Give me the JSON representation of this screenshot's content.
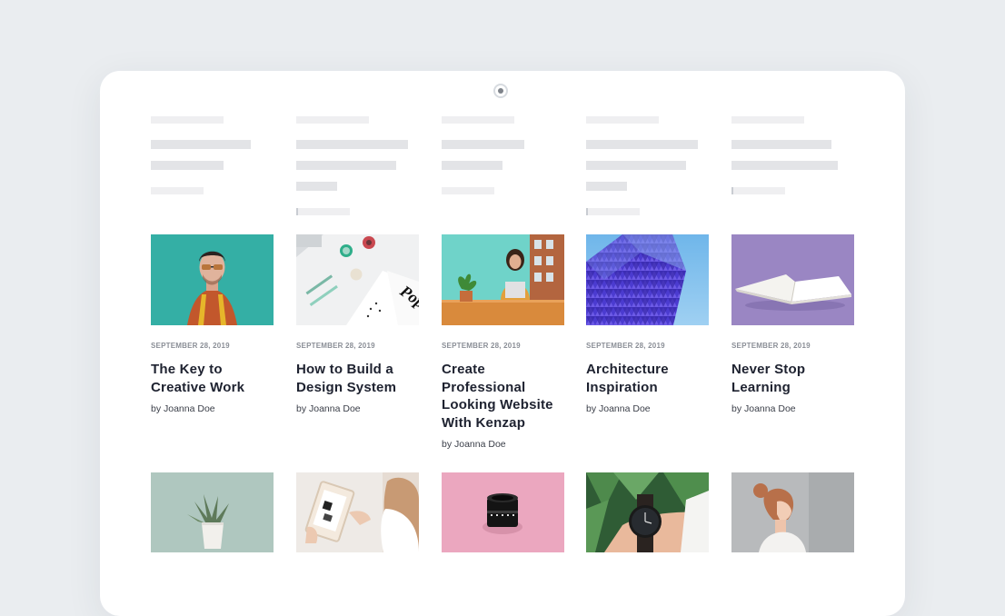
{
  "posts_top": [
    {
      "date": "SEPTEMBER 28, 2019",
      "title": "The Key to Creative Work",
      "author": "by Joanna Doe",
      "image": "man-portrait-teal"
    },
    {
      "date": "SEPTEMBER 28, 2019",
      "title": "How to Build a Design System",
      "author": "by Joanna Doe",
      "image": "desk-flatlay"
    },
    {
      "date": "SEPTEMBER 28, 2019",
      "title": "Create Professional Looking Website With Kenzap",
      "author": "by Joanna Doe",
      "image": "woman-laptop"
    },
    {
      "date": "SEPTEMBER 28, 2019",
      "title": "Architecture Inspiration",
      "author": "by Joanna Doe",
      "image": "blue-building"
    },
    {
      "date": "SEPTEMBER 28, 2019",
      "title": "Never Stop Learning",
      "author": "by Joanna Doe",
      "image": "open-book-purple"
    }
  ],
  "posts_bottom": [
    {
      "image": "succulent-pot"
    },
    {
      "image": "tablet-hands"
    },
    {
      "image": "camera-lens-pink"
    },
    {
      "image": "wrist-watch"
    },
    {
      "image": "woman-profile"
    }
  ],
  "colors": {
    "background": "#eaedf0",
    "card": "#ffffff",
    "title": "#1e2230",
    "date": "#8a8e96"
  }
}
